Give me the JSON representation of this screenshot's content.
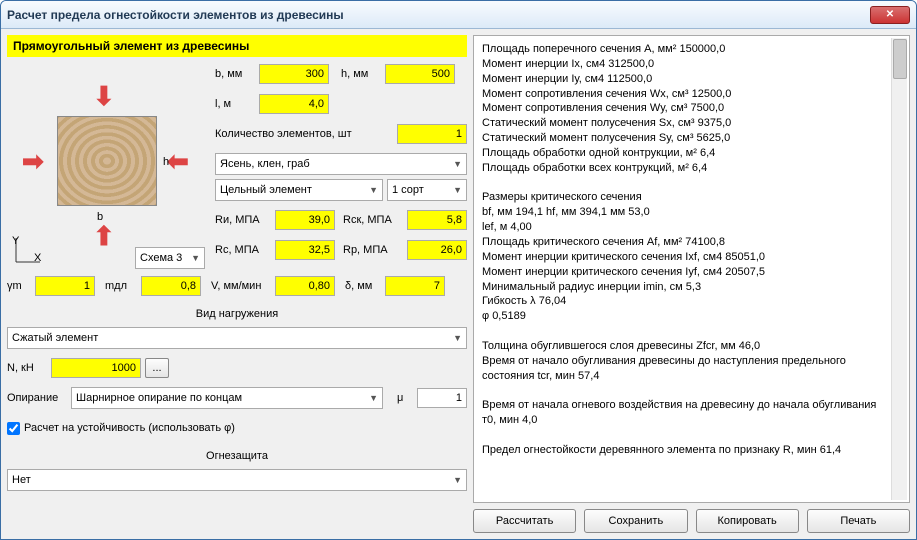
{
  "title": "Расчет предела огнестойкости элементов из древесины",
  "header": "Прямоугольный элемент из древесины",
  "inputs": {
    "b_label": "b, мм",
    "b": "300",
    "h_label": "h, мм",
    "h": "500",
    "l_label": "l, м",
    "l": "4,0",
    "count_label": "Количество элементов, шт",
    "count": "1",
    "wood": "Ясень, клен, граб",
    "solidity": "Цельный элемент",
    "grade": "1 сорт",
    "scheme": "Схема 3",
    "Ri_label": "Rи, МПА",
    "Ri": "39,0",
    "Rck_label": "Rск, МПА",
    "Rck": "5,8",
    "Rc_label": "Rс, МПА",
    "Rc": "32,5",
    "Rp_label": "Rр, МПА",
    "Rp": "26,0",
    "ym_label": "γm",
    "ym": "1",
    "mdl_label": "mдл",
    "mdl": "0,8",
    "V_label": "V, мм/мин",
    "V": "0,80",
    "delta_label": "δ, мм",
    "delta": "7",
    "loading_title": "Вид нагружения",
    "loading": "Сжатый элемент",
    "N_label": "N, кН",
    "N": "1000",
    "support_label": "Опирание",
    "support": "Шарнирное опирание по концам",
    "mu_label": "μ",
    "mu": "1",
    "stability_check": "Расчет на устойчивость (использовать φ)",
    "fireprotect_title": "Огнезащита",
    "fireprotect": "Нет"
  },
  "output_lines": [
    "Площадь поперечного сечения А, мм²   150000,0",
    "Момент инерции Iх, см4   312500,0",
    "Момент инерции Iу, см4   112500,0",
    "Момент сопротивления сечения Wх, см³   12500,0",
    "Момент сопротивления сечения Wу, см³   7500,0",
    "Статический момент полусечения Sх, см³   9375,0",
    "Статический момент полусечения Sу, см³   5625,0",
    "Площадь обработки одной контрукции, м²   6,4",
    "Площадь обработки всех контрукций, м²   6,4",
    "",
    "Размеры критического сечения",
    "bf, мм  194,1  hf, мм   394,1  мм  53,0",
    "lef, м   4,00",
    "Площадь критического сечения Af, мм²   74100,8",
    "Момент инерции критического сечения Iхf, см4   85051,0",
    "Момент инерции критического сечения Iуf, см4   20507,5",
    "Минимальный радиус инерции imin, см   5,3",
    "Гибкость λ 76,04",
    "φ  0,5189",
    "",
    "Толщина обуглившегося слоя древесины Zfcr, мм   46,0",
    "Время от начало обугливания  древесины до наступления предельного состояния tcr, мин   57,4",
    "",
    "Время от начала огневого воздействия на древесину до начала обугливания т0, мин  4,0",
    "",
    "Предел огнестойкости деревянного элемента по признаку R, мин  61,4"
  ],
  "buttons": {
    "calc": "Рассчитать",
    "save": "Сохранить",
    "copy": "Копировать",
    "print": "Печать"
  }
}
